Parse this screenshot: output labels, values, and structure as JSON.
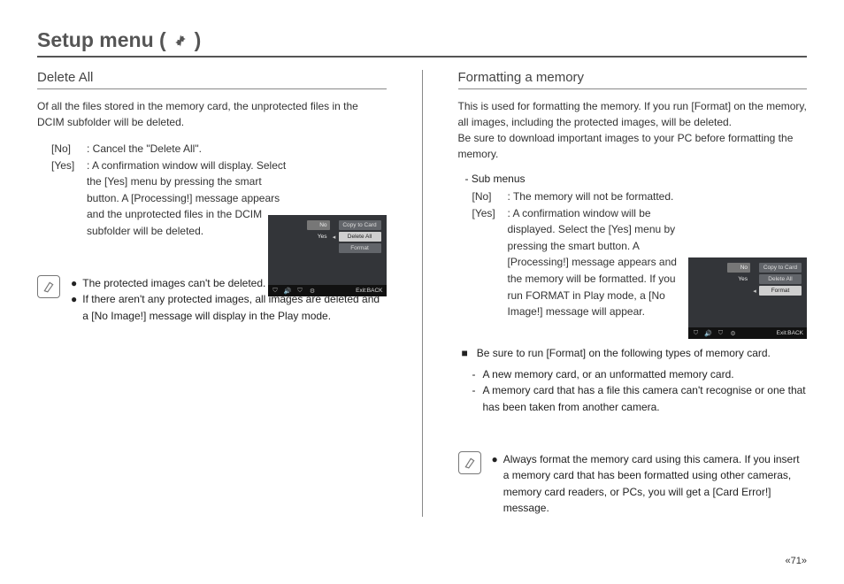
{
  "title_prefix": "Setup menu (",
  "title_suffix": ")",
  "left": {
    "heading": "Delete All",
    "intro": "Of all the files stored in the memory card, the unprotected files in the DCIM subfolder will be deleted.",
    "sub_no_key": "[No]",
    "sub_no_val": ": Cancel the \"Delete All\".",
    "sub_yes_key": "[Yes]",
    "sub_yes_val": ": A confirmation window will display. Select the [Yes] menu by pressing the smart button. A [Processing!] message appears and the unprotected files in the DCIM subfolder will be deleted.",
    "note1": "The protected images can't be deleted.",
    "note2": "If there aren't any protected images, all images are deleted and a [No Image!] message will display in the Play mode."
  },
  "right": {
    "heading": "Formatting a memory",
    "intro": "This is used for formatting the memory. If you run [Format] on the memory, all images, including the protected images, will be deleted.\nBe sure to download important images to your PC before formatting the memory.",
    "sub_label": "- Sub menus",
    "sub_no_key": "[No]",
    "sub_no_val": ": The memory will not be formatted.",
    "sub_yes_key": "[Yes]",
    "sub_yes_val": ": A confirmation window will be displayed. Select the [Yes] menu by pressing the smart button. A [Processing!] message appears and the memory will be formatted. If you run FORMAT in Play mode, a [No Image!] message will appear.",
    "bullet_intro": "Be sure to run [Format] on the following types of memory card.",
    "dash1": "A new memory card, or an unformatted memory card.",
    "dash2": "A memory card that has a file this camera can't recognise or one that has been taken from another camera.",
    "note1": "Always format the memory card using this camera. If you insert a memory card that has been formatted using other cameras, memory card readers, or PCs, you will get a [Card Error!] message."
  },
  "screenshot": {
    "no": "No",
    "yes": "Yes",
    "copy": "Copy to Card",
    "delete": "Delete All",
    "format": "Format",
    "exit": "Exit:BACK"
  },
  "page_number": "«71»"
}
